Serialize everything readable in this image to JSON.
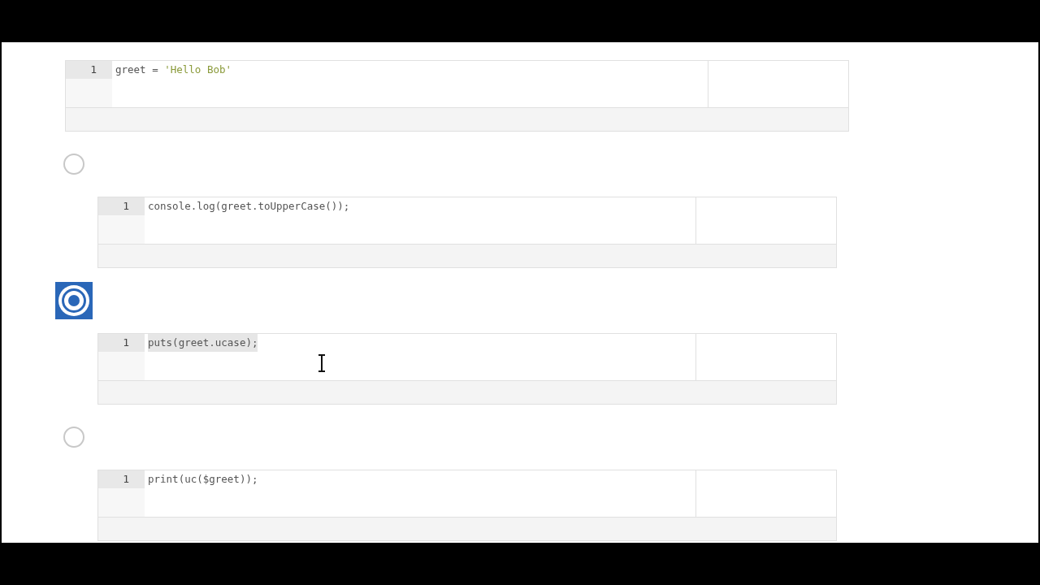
{
  "prompt_code": {
    "line_number": "1",
    "highlighted": false,
    "tokens": [
      {
        "text": "greet = ",
        "kind": "plain"
      },
      {
        "text": "'Hello Bob'",
        "kind": "string"
      }
    ]
  },
  "options": [
    {
      "selected": false,
      "code": {
        "line_number": "1",
        "highlighted": false,
        "text": "console.log(greet.toUpperCase());"
      }
    },
    {
      "selected": true,
      "code": {
        "line_number": "1",
        "highlighted": true,
        "text": "puts(greet.ucase);"
      }
    },
    {
      "selected": false,
      "code": {
        "line_number": "1",
        "highlighted": false,
        "text": "print(uc($greet));"
      }
    }
  ]
}
